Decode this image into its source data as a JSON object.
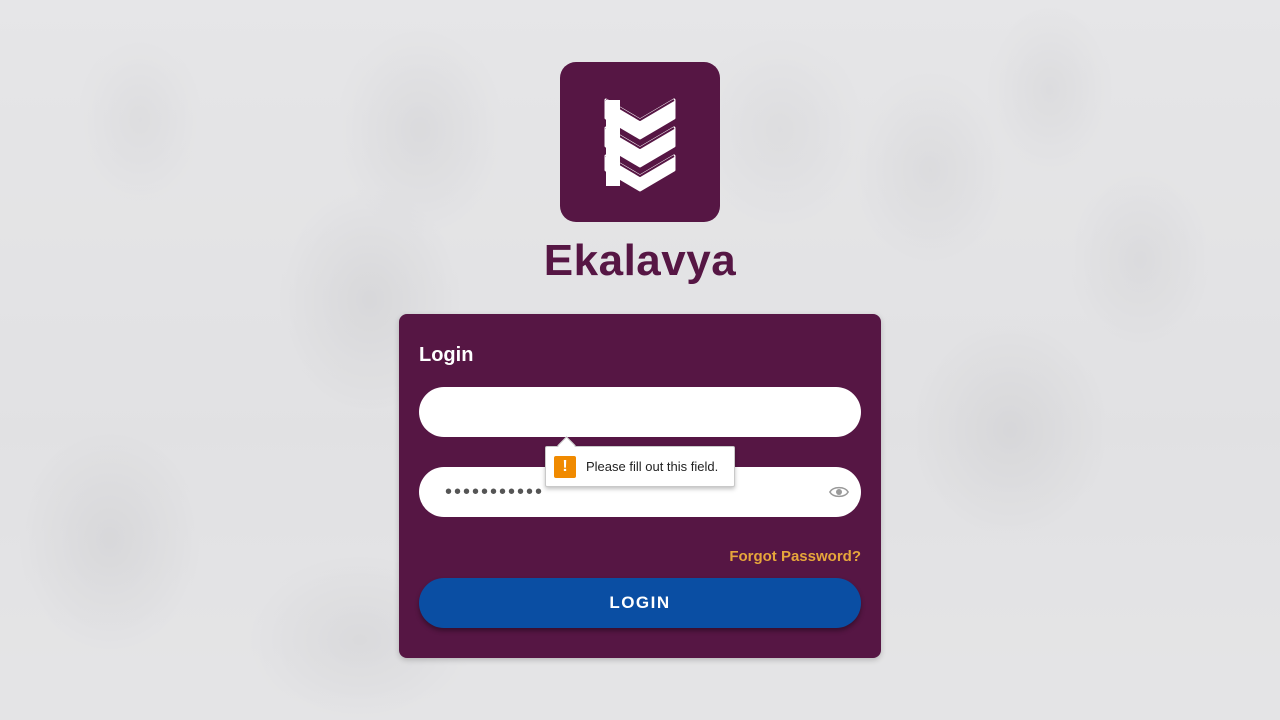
{
  "brand": {
    "name": "Ekalavya",
    "logo_icon": "ekalavya-logo-icon",
    "color": "#561644"
  },
  "login_form": {
    "title": "Login",
    "username": {
      "value": "",
      "placeholder": ""
    },
    "password": {
      "value": "•••••••••••",
      "placeholder": ""
    },
    "password_toggle_icon": "eye-icon",
    "forgot_password": "Forgot Password?",
    "submit_label": "LOGIN"
  },
  "validation_tooltip": {
    "icon": "warning-icon",
    "message": "Please fill out this field."
  },
  "colors": {
    "card": "#561644",
    "button": "#0a4ea3",
    "link": "#e6a63b",
    "warning": "#f08a00"
  }
}
